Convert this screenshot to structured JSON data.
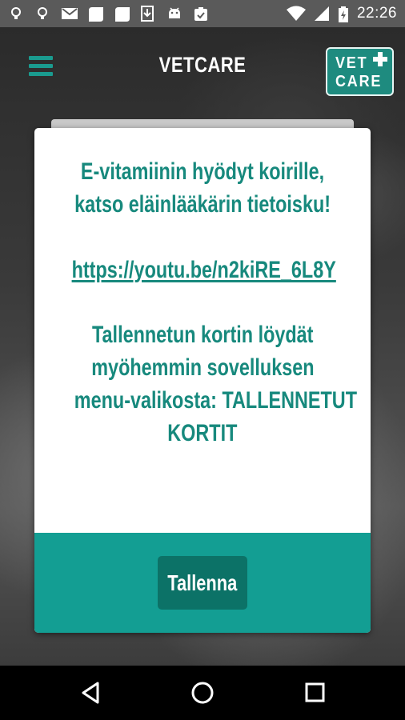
{
  "status_bar": {
    "time": "22:26",
    "icons": [
      "bulb-icon",
      "bulb-icon",
      "mail-icon",
      "square-icon",
      "square-icon",
      "download-icon",
      "android-icon",
      "clipboard-check-icon",
      "wifi-icon",
      "signal-icon",
      "battery-charging-icon"
    ]
  },
  "header": {
    "title": "VETCARE",
    "logo_line1": "VET",
    "logo_line2": "CARE"
  },
  "dialog": {
    "line1": "E-vitamiinin hyödyt koirille,",
    "line2": "katso eläinlääkärin tietoisku!",
    "link": "https://youtu.be/n2kiRE_6L8Y",
    "info1": "Tallennetun kortin löydät",
    "info2": "myöhemmin sovelluksen",
    "info3": "menu-valikosta: TALLENNETUT",
    "info4": "KORTIT",
    "save_label": "Tallenna"
  },
  "colors": {
    "accent": "#17897d",
    "footer": "#139e93",
    "button": "#0c7267"
  }
}
